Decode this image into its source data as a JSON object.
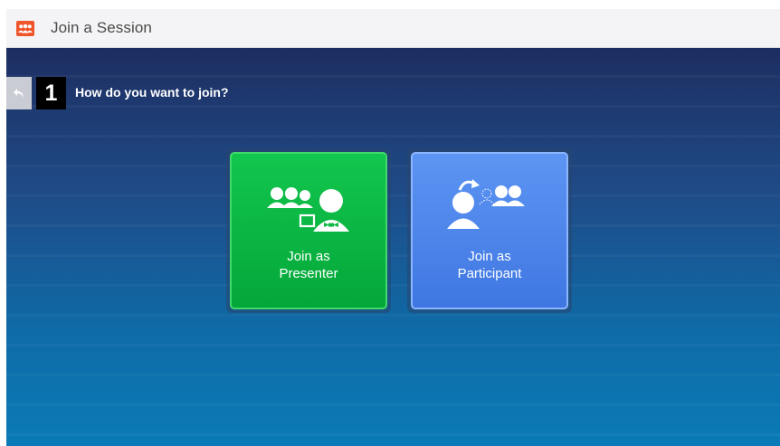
{
  "window": {
    "title": "Join a Session",
    "app_icon": "people-group-icon",
    "accent": "#f0542b"
  },
  "step": {
    "number": "1",
    "question": "How do you want to join?",
    "back_icon": "back-arrow-icon"
  },
  "options": [
    {
      "id": "presenter",
      "line1": "Join as",
      "line2": "Presenter",
      "icon": "presenter-group-icon",
      "color": "#0cb845"
    },
    {
      "id": "participant",
      "line1": "Join as",
      "line2": "Participant",
      "icon": "participant-join-icon",
      "color": "#4c86ec"
    }
  ]
}
